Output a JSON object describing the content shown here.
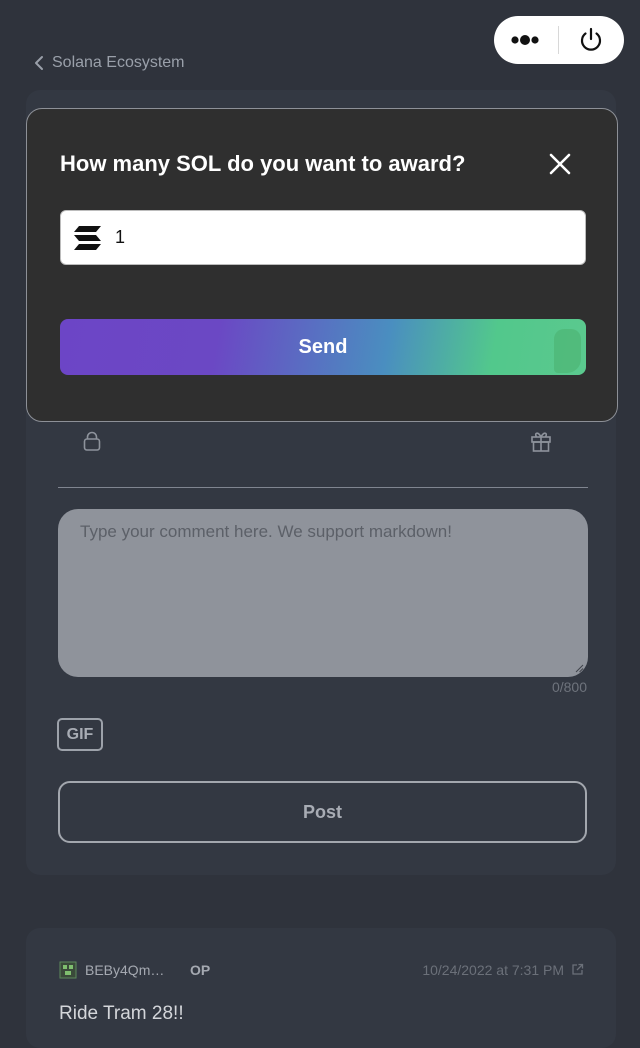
{
  "nav": {
    "back_label": "Solana Ecosystem"
  },
  "capsule": {
    "more_icon": "more-dots-icon",
    "power_icon": "power-icon"
  },
  "composer": {
    "comment_placeholder": "Type your comment here. We support markdown!",
    "char_counter": "0/800",
    "gif_label": "GIF",
    "post_label": "Post"
  },
  "comment": {
    "author": "BEBy4Qm…",
    "op_badge": "OP",
    "timestamp": "10/24/2022 at 7:31 PM",
    "text": "Ride Tram 28!!"
  },
  "award_modal": {
    "title": "How many SOL do you want to award?",
    "amount_value": "1",
    "send_label": "Send",
    "currency_icon": "solana-icon"
  },
  "colors": {
    "background": "#2f333c",
    "card": "#333842",
    "modal": "#2f2f2f",
    "send_gradient_start": "#6c45c6",
    "send_gradient_end": "#5bc98e"
  }
}
